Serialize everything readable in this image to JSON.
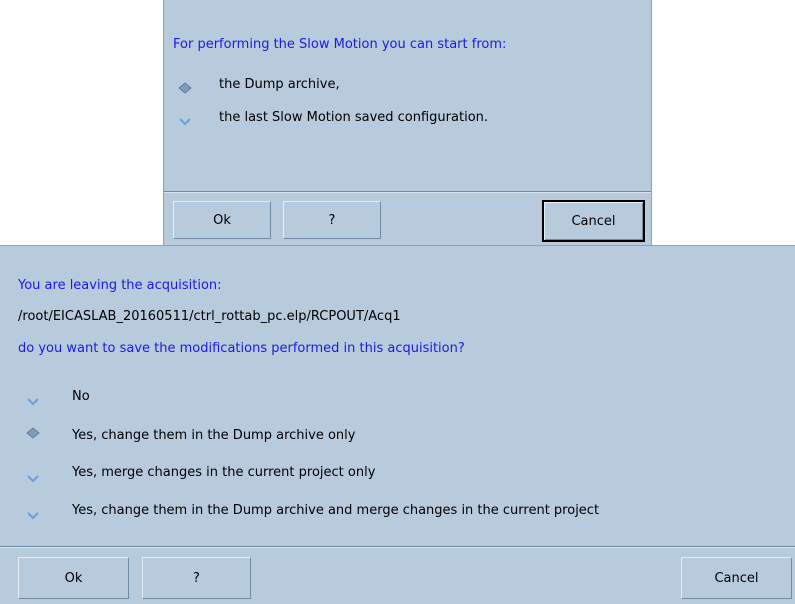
{
  "slow_motion_dialog": {
    "message": "For performing the Slow Motion you can start from:",
    "options": [
      {
        "label": "the Dump archive,",
        "selected": true
      },
      {
        "label": "the last Slow Motion saved configuration.",
        "selected": false
      }
    ],
    "buttons": {
      "ok": "Ok",
      "help": "?",
      "cancel": "Cancel"
    }
  },
  "leave_acquisition_dialog": {
    "message_line1": "You are leaving the acquisition:",
    "message_path": "/root/EICASLAB_20160511/ctrl_rottab_pc.elp/RCPOUT/Acq1",
    "message_line3": "do you want to save the modifications performed in this acquisition?",
    "options": [
      {
        "label": "No",
        "selected": false
      },
      {
        "label": "Yes, change them in the Dump archive only",
        "selected": true
      },
      {
        "label": "Yes, merge changes in the current project only",
        "selected": false
      },
      {
        "label": "Yes, change them in the Dump archive and merge changes in the current project",
        "selected": false
      }
    ],
    "buttons": {
      "ok": "Ok",
      "help": "?",
      "cancel": "Cancel"
    }
  },
  "colors": {
    "dialog_bg": "#b7cbdd",
    "message_text": "#1a1ae0",
    "radio_selected": "#5b7fa6",
    "radio_unselected": "#6a9fd6"
  }
}
